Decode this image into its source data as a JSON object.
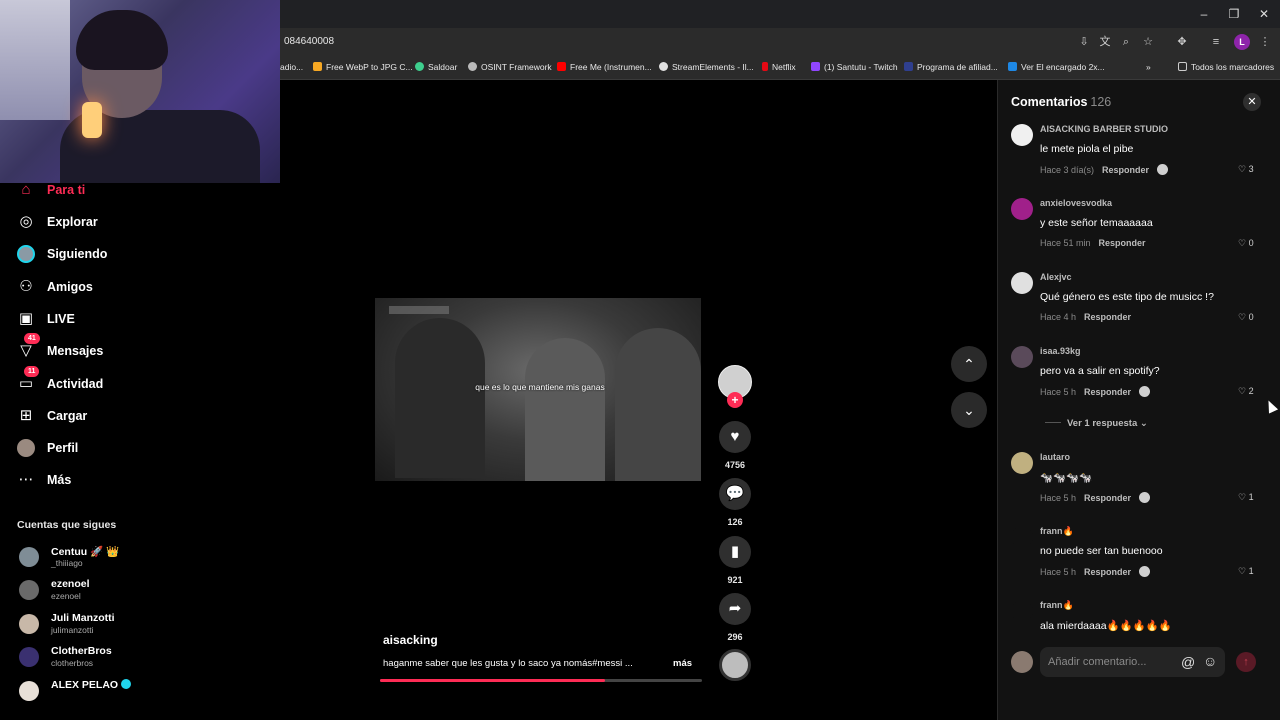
{
  "browser": {
    "url": "084640008",
    "bookmarks": [
      {
        "label": "adio...",
        "color": "#7a7a7a"
      },
      {
        "label": "Free WebP to JPG C...",
        "color": "#f7a823"
      },
      {
        "label": "Saldoar",
        "color": "#3ecf8e"
      },
      {
        "label": "OSINT Framework",
        "color": "#bbbbbb"
      },
      {
        "label": "Free Me (Instrumen...",
        "color": "#ff0000"
      },
      {
        "label": "StreamElements - Il...",
        "color": "#e0e0e0"
      },
      {
        "label": "Netflix",
        "color": "#e50914"
      },
      {
        "label": "(1) Santutu - Twitch",
        "color": "#9146ff"
      },
      {
        "label": "Programa de afiliad...",
        "color": "#2f3f8f"
      },
      {
        "label": "Ver El encargado 2x...",
        "color": "#1e88e5"
      }
    ],
    "all_bookmarks_label": "Todos los marcadores",
    "profile_initial": "L"
  },
  "sidebar": {
    "items": [
      {
        "label": "Para ti",
        "icon": "home-icon",
        "active": true
      },
      {
        "label": "Explorar",
        "icon": "compass-icon"
      },
      {
        "label": "Siguiendo",
        "icon": "following-avatar-icon"
      },
      {
        "label": "Amigos",
        "icon": "friends-icon"
      },
      {
        "label": "LIVE",
        "icon": "live-icon"
      },
      {
        "label": "Mensajes",
        "icon": "messages-icon",
        "badge": "41"
      },
      {
        "label": "Actividad",
        "icon": "activity-icon",
        "badge": "11"
      },
      {
        "label": "Cargar",
        "icon": "upload-icon"
      },
      {
        "label": "Perfil",
        "icon": "profile-avatar-icon"
      },
      {
        "label": "Más",
        "icon": "more-icon"
      }
    ],
    "following_title": "Cuentas que sigues",
    "accounts": [
      {
        "name": "Centuu 🚀 👑",
        "handle": "_thiiiago"
      },
      {
        "name": "ezenoel",
        "handle": "ezenoel"
      },
      {
        "name": "Juli Manzotti",
        "handle": "julimanzotti"
      },
      {
        "name": "ClotherBros",
        "handle": "clotherbros"
      },
      {
        "name": "ALEX PELAO",
        "handle": "",
        "verified": true
      }
    ]
  },
  "video": {
    "subtitle": "que es lo que mantiene mis ganas",
    "author": "aisacking",
    "caption": "haganme saber que les gusta y lo saco ya nomás#messi ...",
    "more_label": "más",
    "progress": 0.7
  },
  "actions": {
    "likes": "4756",
    "comments": "126",
    "saves": "921",
    "shares": "296"
  },
  "comments_panel": {
    "title": "Comentarios",
    "count": "126",
    "reply_label": "Responder",
    "view_replies": "Ver 1 respuesta ⌄",
    "input_placeholder": "Añadir comentario...",
    "comments": [
      {
        "user": "AISACKING BARBER STUDIO",
        "text": "le mete piola el pibe",
        "time": "Hace 3 día(s)",
        "likes": "3",
        "creator_liked": true
      },
      {
        "user": "anxielovesvodka",
        "text": "y este señor temaaaaaa",
        "time": "Hace 51 min",
        "likes": "0",
        "creator_liked": false
      },
      {
        "user": "Alexjvc",
        "text": "Qué género es este tipo de musicc !?",
        "time": "Hace 4 h",
        "likes": "0",
        "creator_liked": false
      },
      {
        "user": "isaa.93kg",
        "text": "pero va a salir en spotify?",
        "time": "Hace 5 h",
        "likes": "2",
        "creator_liked": true
      },
      {
        "user": "lautaro",
        "text": "🐄🐄🐄🐄",
        "time": "Hace 5 h",
        "likes": "1",
        "creator_liked": true
      },
      {
        "user": "frann🔥",
        "text": "no puede ser tan buenooo",
        "time": "Hace 5 h",
        "likes": "1",
        "creator_liked": true
      },
      {
        "user": "frann🔥",
        "text": "ala mierdaaaa🔥🔥🔥🔥🔥",
        "time": "",
        "likes": "",
        "creator_liked": false
      }
    ]
  }
}
